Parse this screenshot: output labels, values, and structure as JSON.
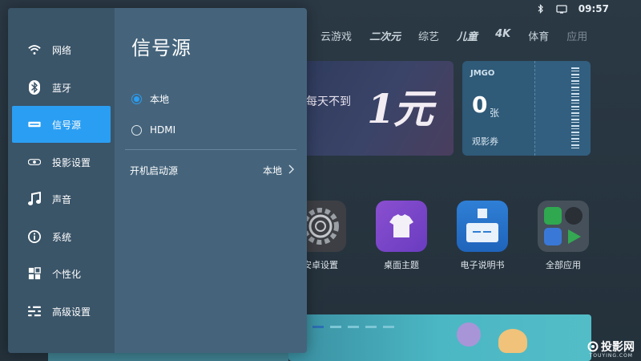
{
  "status_bar": {
    "time": "09:57",
    "icons": [
      "bluetooth-icon",
      "tv-icon"
    ]
  },
  "categories": [
    "云游戏",
    "二次元",
    "综艺",
    "儿童",
    "4K",
    "体育",
    "应用"
  ],
  "banner": {
    "text": "每天不到",
    "big_text": "1元"
  },
  "ticket": {
    "brand": "JMGO",
    "count": "0",
    "unit": "张",
    "label": "观影券"
  },
  "apps": [
    {
      "label": "安卓设置",
      "icon": "gear-icon"
    },
    {
      "label": "桌面主题",
      "icon": "tshirt-icon"
    },
    {
      "label": "电子说明书",
      "icon": "manual-icon"
    },
    {
      "label": "全部应用",
      "icon": "app-grid-icon"
    }
  ],
  "watermark": {
    "text": "投影网",
    "sub": "TOUYING.COM"
  },
  "sidebar": {
    "items": [
      {
        "label": "网络",
        "icon": "wifi-icon"
      },
      {
        "label": "蓝牙",
        "icon": "bluetooth-icon"
      },
      {
        "label": "信号源",
        "icon": "input-source-icon",
        "active": true
      },
      {
        "label": "投影设置",
        "icon": "projector-icon"
      },
      {
        "label": "声音",
        "icon": "music-note-icon"
      },
      {
        "label": "系统",
        "icon": "info-icon"
      },
      {
        "label": "个性化",
        "icon": "grid-icon"
      },
      {
        "label": "高级设置",
        "icon": "sliders-icon"
      }
    ]
  },
  "main": {
    "title": "信号源",
    "options": [
      {
        "label": "本地",
        "selected": true
      },
      {
        "label": "HDMI",
        "selected": false
      }
    ],
    "boot_source": {
      "label": "开机启动源",
      "value": "本地"
    }
  },
  "colors": {
    "accent": "#2a9ef2",
    "panel": "#45647c",
    "sidebar": "#3a5468"
  }
}
